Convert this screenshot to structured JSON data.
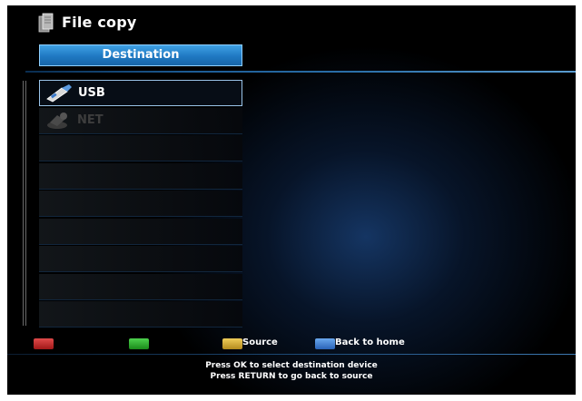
{
  "header": {
    "title": "File copy",
    "destination_tab": "Destination"
  },
  "devices": [
    {
      "label": "USB",
      "icon": "usb-icon",
      "state": "selected"
    },
    {
      "label": "NET",
      "icon": "network-icon",
      "state": "disabled"
    }
  ],
  "empty_rows": 7,
  "color_keys": {
    "red": {
      "label": "",
      "color": "#c02828"
    },
    "green": {
      "label": "",
      "color": "#2aa62a"
    },
    "yellow": {
      "label": "Source",
      "color": "#d6a830"
    },
    "blue": {
      "label": "Back to home",
      "color": "#3f7fd2"
    }
  },
  "help": {
    "line1": "Press OK to select destination device",
    "line2": "Press RETURN to go back to source"
  },
  "colors": {
    "accent": "#2a86d0",
    "background": "#000000"
  }
}
